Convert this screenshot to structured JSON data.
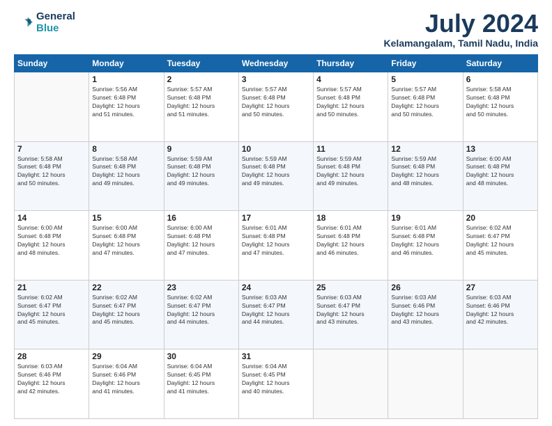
{
  "header": {
    "logo_line1": "General",
    "logo_line2": "Blue",
    "month_title": "July 2024",
    "location": "Kelamangalam, Tamil Nadu, India"
  },
  "days_of_week": [
    "Sunday",
    "Monday",
    "Tuesday",
    "Wednesday",
    "Thursday",
    "Friday",
    "Saturday"
  ],
  "weeks": [
    [
      {
        "day": "",
        "info": ""
      },
      {
        "day": "1",
        "info": "Sunrise: 5:56 AM\nSunset: 6:48 PM\nDaylight: 12 hours\nand 51 minutes."
      },
      {
        "day": "2",
        "info": "Sunrise: 5:57 AM\nSunset: 6:48 PM\nDaylight: 12 hours\nand 51 minutes."
      },
      {
        "day": "3",
        "info": "Sunrise: 5:57 AM\nSunset: 6:48 PM\nDaylight: 12 hours\nand 50 minutes."
      },
      {
        "day": "4",
        "info": "Sunrise: 5:57 AM\nSunset: 6:48 PM\nDaylight: 12 hours\nand 50 minutes."
      },
      {
        "day": "5",
        "info": "Sunrise: 5:57 AM\nSunset: 6:48 PM\nDaylight: 12 hours\nand 50 minutes."
      },
      {
        "day": "6",
        "info": "Sunrise: 5:58 AM\nSunset: 6:48 PM\nDaylight: 12 hours\nand 50 minutes."
      }
    ],
    [
      {
        "day": "7",
        "info": "Sunrise: 5:58 AM\nSunset: 6:48 PM\nDaylight: 12 hours\nand 50 minutes."
      },
      {
        "day": "8",
        "info": "Sunrise: 5:58 AM\nSunset: 6:48 PM\nDaylight: 12 hours\nand 49 minutes."
      },
      {
        "day": "9",
        "info": "Sunrise: 5:59 AM\nSunset: 6:48 PM\nDaylight: 12 hours\nand 49 minutes."
      },
      {
        "day": "10",
        "info": "Sunrise: 5:59 AM\nSunset: 6:48 PM\nDaylight: 12 hours\nand 49 minutes."
      },
      {
        "day": "11",
        "info": "Sunrise: 5:59 AM\nSunset: 6:48 PM\nDaylight: 12 hours\nand 49 minutes."
      },
      {
        "day": "12",
        "info": "Sunrise: 5:59 AM\nSunset: 6:48 PM\nDaylight: 12 hours\nand 48 minutes."
      },
      {
        "day": "13",
        "info": "Sunrise: 6:00 AM\nSunset: 6:48 PM\nDaylight: 12 hours\nand 48 minutes."
      }
    ],
    [
      {
        "day": "14",
        "info": "Sunrise: 6:00 AM\nSunset: 6:48 PM\nDaylight: 12 hours\nand 48 minutes."
      },
      {
        "day": "15",
        "info": "Sunrise: 6:00 AM\nSunset: 6:48 PM\nDaylight: 12 hours\nand 47 minutes."
      },
      {
        "day": "16",
        "info": "Sunrise: 6:00 AM\nSunset: 6:48 PM\nDaylight: 12 hours\nand 47 minutes."
      },
      {
        "day": "17",
        "info": "Sunrise: 6:01 AM\nSunset: 6:48 PM\nDaylight: 12 hours\nand 47 minutes."
      },
      {
        "day": "18",
        "info": "Sunrise: 6:01 AM\nSunset: 6:48 PM\nDaylight: 12 hours\nand 46 minutes."
      },
      {
        "day": "19",
        "info": "Sunrise: 6:01 AM\nSunset: 6:48 PM\nDaylight: 12 hours\nand 46 minutes."
      },
      {
        "day": "20",
        "info": "Sunrise: 6:02 AM\nSunset: 6:47 PM\nDaylight: 12 hours\nand 45 minutes."
      }
    ],
    [
      {
        "day": "21",
        "info": "Sunrise: 6:02 AM\nSunset: 6:47 PM\nDaylight: 12 hours\nand 45 minutes."
      },
      {
        "day": "22",
        "info": "Sunrise: 6:02 AM\nSunset: 6:47 PM\nDaylight: 12 hours\nand 45 minutes."
      },
      {
        "day": "23",
        "info": "Sunrise: 6:02 AM\nSunset: 6:47 PM\nDaylight: 12 hours\nand 44 minutes."
      },
      {
        "day": "24",
        "info": "Sunrise: 6:03 AM\nSunset: 6:47 PM\nDaylight: 12 hours\nand 44 minutes."
      },
      {
        "day": "25",
        "info": "Sunrise: 6:03 AM\nSunset: 6:47 PM\nDaylight: 12 hours\nand 43 minutes."
      },
      {
        "day": "26",
        "info": "Sunrise: 6:03 AM\nSunset: 6:46 PM\nDaylight: 12 hours\nand 43 minutes."
      },
      {
        "day": "27",
        "info": "Sunrise: 6:03 AM\nSunset: 6:46 PM\nDaylight: 12 hours\nand 42 minutes."
      }
    ],
    [
      {
        "day": "28",
        "info": "Sunrise: 6:03 AM\nSunset: 6:46 PM\nDaylight: 12 hours\nand 42 minutes."
      },
      {
        "day": "29",
        "info": "Sunrise: 6:04 AM\nSunset: 6:46 PM\nDaylight: 12 hours\nand 41 minutes."
      },
      {
        "day": "30",
        "info": "Sunrise: 6:04 AM\nSunset: 6:45 PM\nDaylight: 12 hours\nand 41 minutes."
      },
      {
        "day": "31",
        "info": "Sunrise: 6:04 AM\nSunset: 6:45 PM\nDaylight: 12 hours\nand 40 minutes."
      },
      {
        "day": "",
        "info": ""
      },
      {
        "day": "",
        "info": ""
      },
      {
        "day": "",
        "info": ""
      }
    ]
  ]
}
